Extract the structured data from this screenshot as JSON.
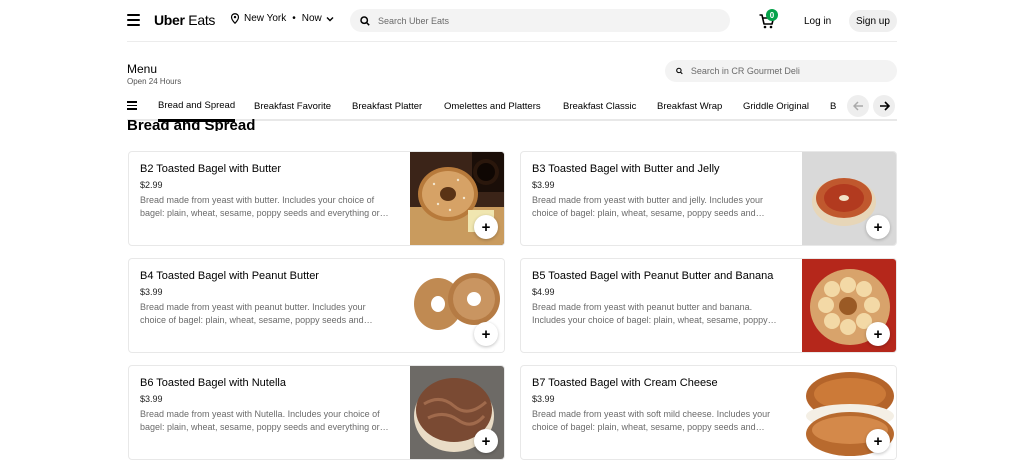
{
  "header": {
    "logo_uber": "Uber",
    "logo_eats": "Eats",
    "location": "New York",
    "time_sep": "•",
    "time": "Now",
    "search_placeholder": "Search Uber Eats",
    "cart_count": "0",
    "login": "Log in",
    "signup": "Sign up"
  },
  "menu": {
    "title": "Menu",
    "subtitle": "Open 24 Hours",
    "search_placeholder": "Search in CR Gourmet Deli"
  },
  "tabs": [
    {
      "label": "Bread and Spread"
    },
    {
      "label": "Breakfast Favorite"
    },
    {
      "label": "Breakfast Platter"
    },
    {
      "label": "Omelettes and Platters"
    },
    {
      "label": "Breakfast Classic"
    },
    {
      "label": "Breakfast Wrap"
    },
    {
      "label": "Griddle Original"
    },
    {
      "label": "B"
    }
  ],
  "section": {
    "title": "Bread and Spread"
  },
  "items": [
    {
      "name": "B2 Toasted Bagel with Butter",
      "price": "$2.99",
      "desc": "Bread made from yeast with butter. Includes your choice of bagel: plain, wheat, sesame, poppy seeds and everything or…"
    },
    {
      "name": "B3 Toasted Bagel with Butter and Jelly",
      "price": "$3.99",
      "desc": "Bread made from yeast with butter and jelly. Includes your choice of bagel: plain, wheat, sesame, poppy seeds and…"
    },
    {
      "name": "B4 Toasted Bagel with Peanut Butter",
      "price": "$3.99",
      "desc": "Bread made from yeast with peanut butter. Includes your choice of bagel: plain, wheat, sesame, poppy seeds and…"
    },
    {
      "name": "B5 Toasted Bagel with Peanut Butter and Banana",
      "price": "$4.99",
      "desc": "Bread made from yeast with peanut butter and banana. Includes your choice of bagel: plain, wheat, sesame, poppy…"
    },
    {
      "name": "B6 Toasted Bagel with Nutella",
      "price": "$3.99",
      "desc": "Bread made from yeast with Nutella. Includes your choice of bagel: plain, wheat, sesame, poppy seeds and everything or…"
    },
    {
      "name": "B7 Toasted Bagel with Cream Cheese",
      "price": "$3.99",
      "desc": "Bread made from yeast with soft mild cheese. Includes your choice of bagel: plain, wheat, sesame, poppy seeds and…"
    }
  ],
  "add_label": "+",
  "colors": {
    "badge": "#06a24a",
    "chip_bg": "#f3f3f3"
  }
}
